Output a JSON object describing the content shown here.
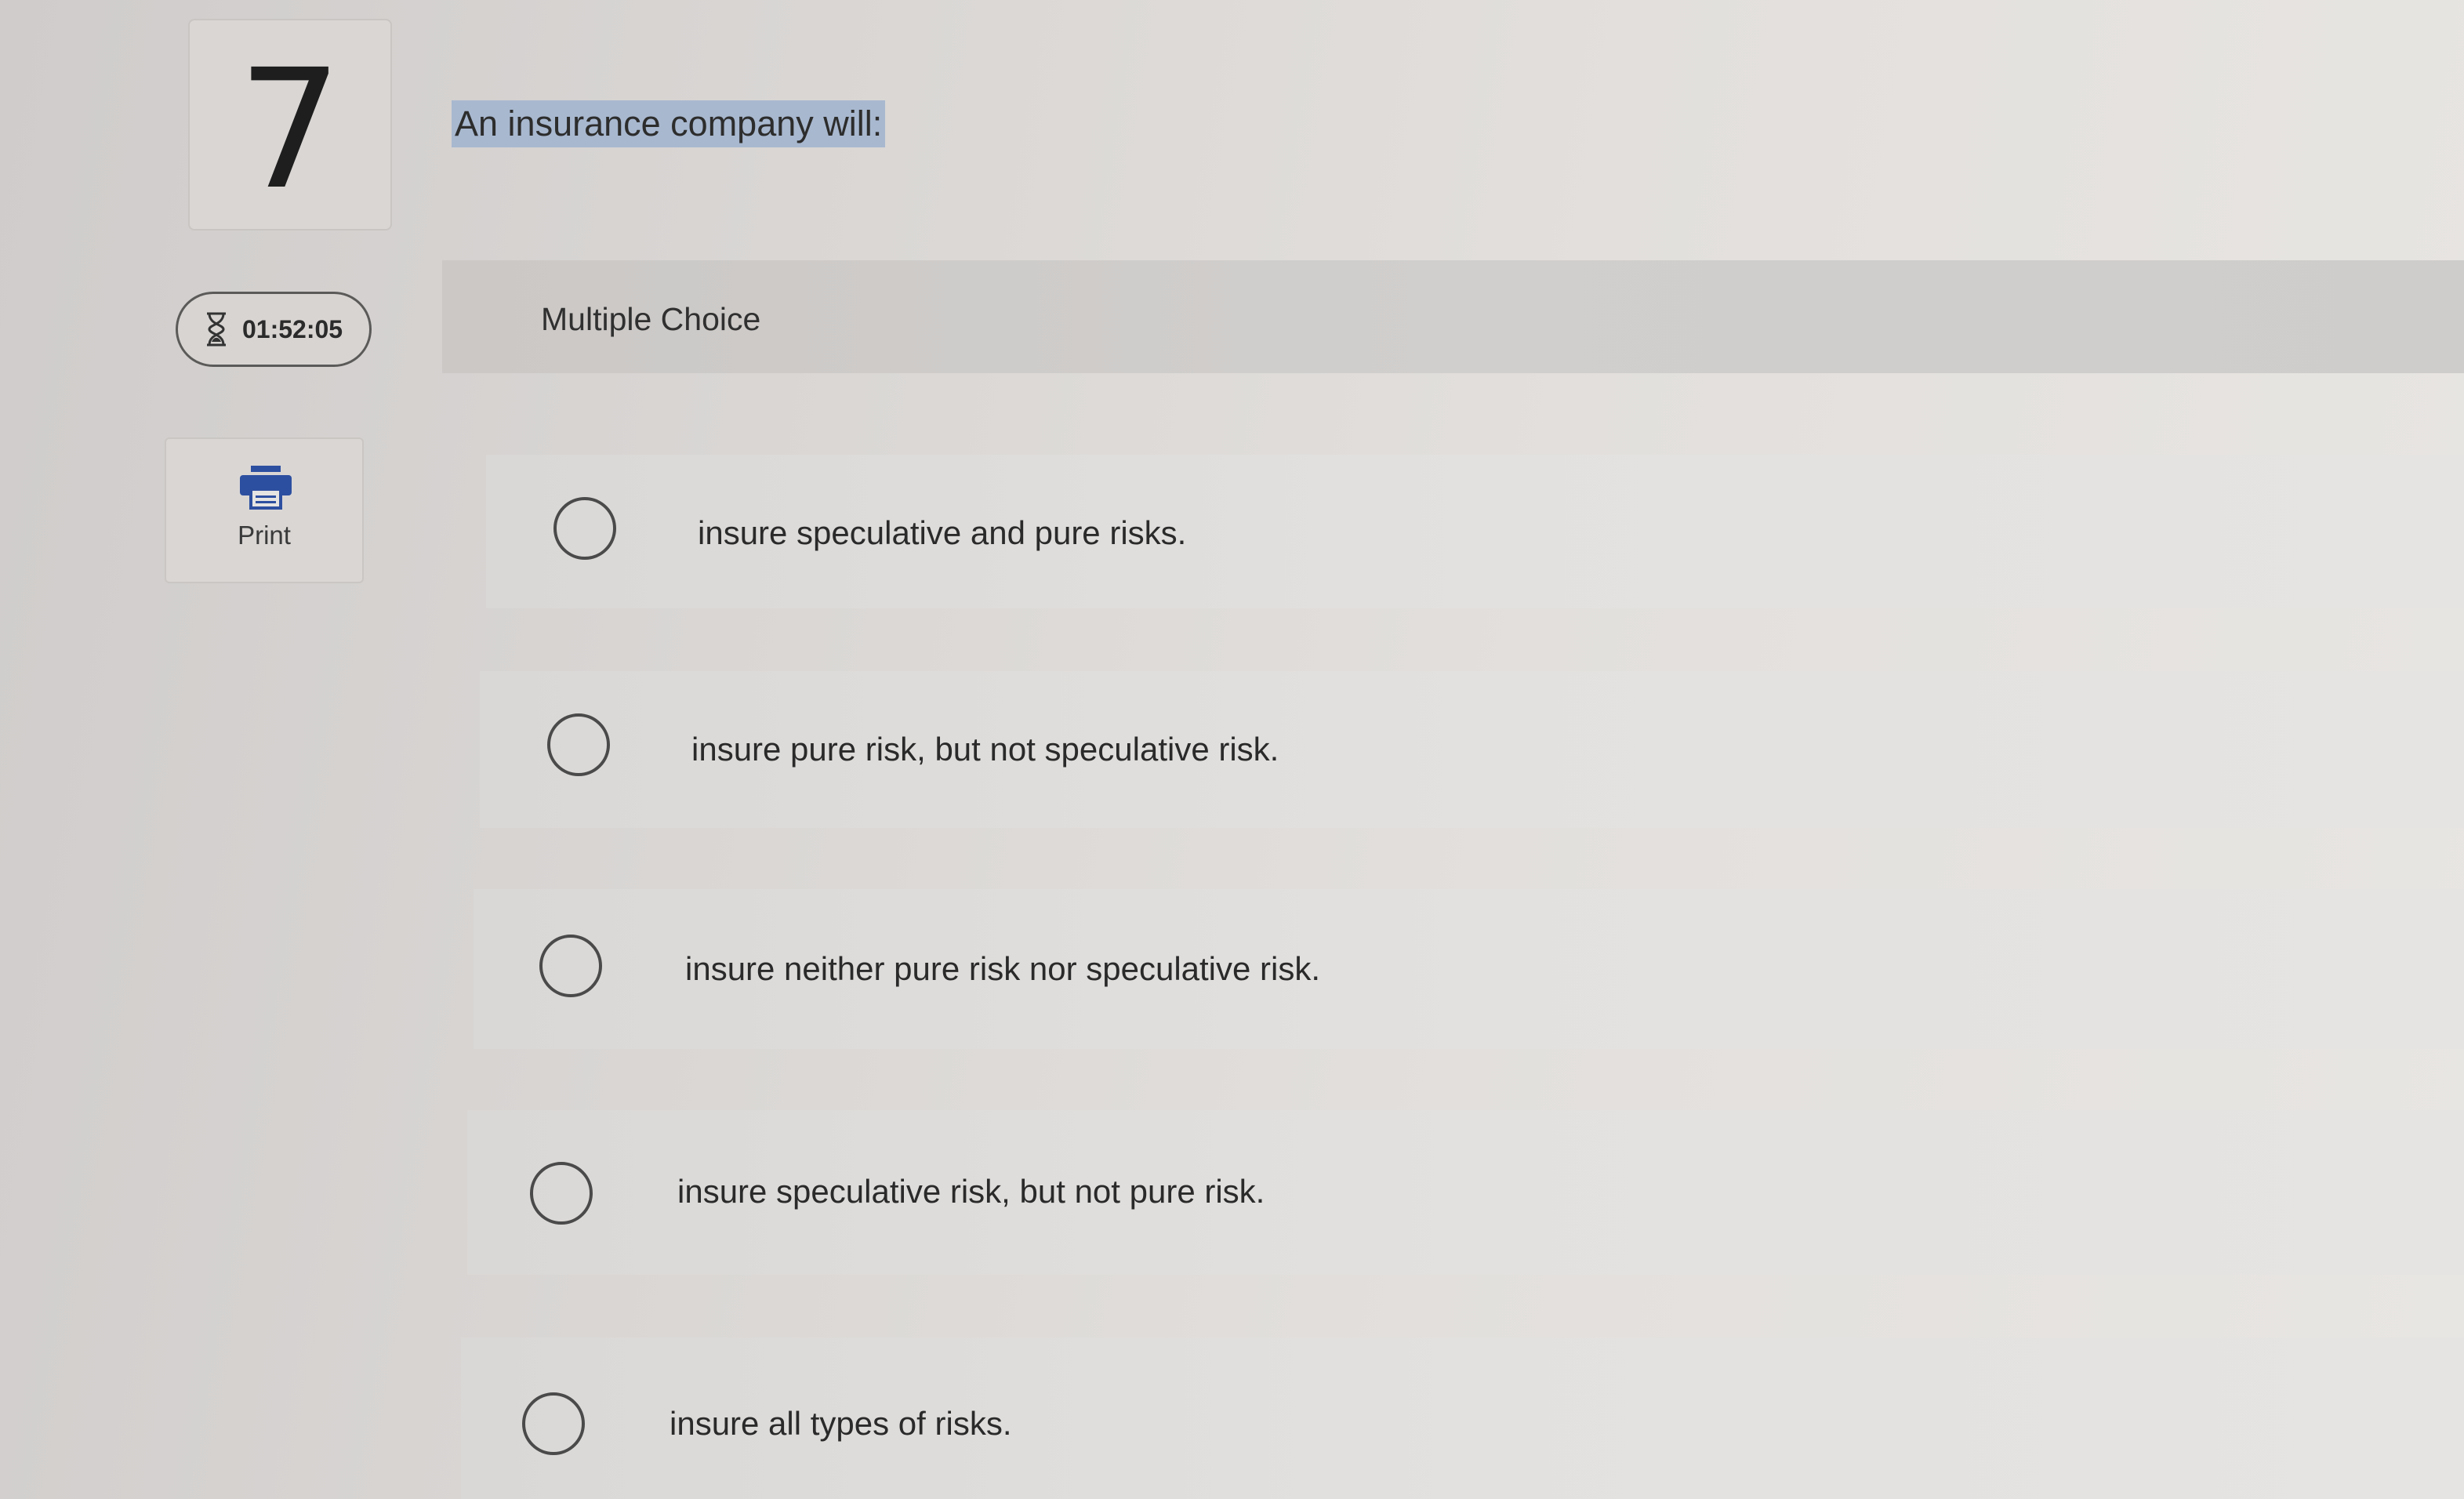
{
  "question": {
    "number": "7",
    "text": "An insurance company will:"
  },
  "sidebar": {
    "timer": "01:52:05",
    "print_label": "Print"
  },
  "question_type": "Multiple Choice",
  "options": [
    {
      "text": "insure speculative and pure risks."
    },
    {
      "text": "insure pure risk, but not speculative risk."
    },
    {
      "text": "insure neither pure risk nor speculative risk."
    },
    {
      "text": "insure speculative risk, but not pure risk."
    },
    {
      "text": "insure all types of risks."
    }
  ],
  "colors": {
    "highlight": "#a8b8cf",
    "print_icon": "#2d4fa0"
  }
}
